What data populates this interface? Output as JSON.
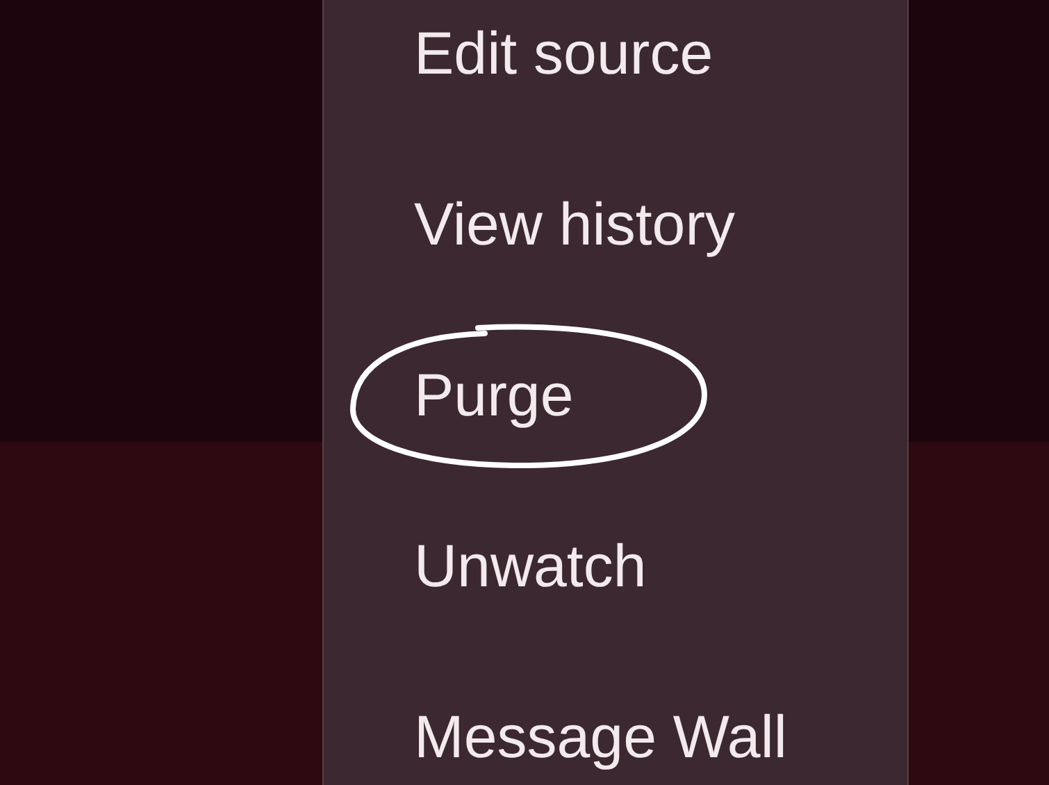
{
  "menu": {
    "items": [
      {
        "label": "Edit source",
        "circled": false
      },
      {
        "label": "View history",
        "circled": false
      },
      {
        "label": "Purge",
        "circled": true
      },
      {
        "label": "Unwatch",
        "circled": false
      },
      {
        "label": "Message Wall",
        "circled": false
      }
    ]
  }
}
